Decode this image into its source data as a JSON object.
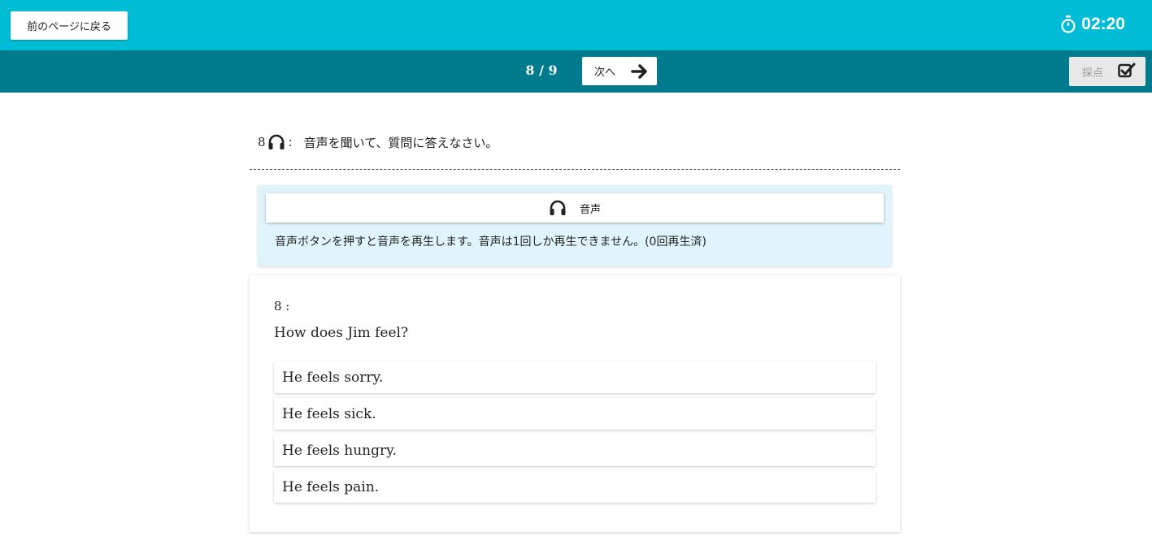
{
  "header": {
    "back_label": "前のページに戻る",
    "timer": "02:20",
    "timer_icon": "stopwatch-icon"
  },
  "nav": {
    "page_counter": "8 / 9",
    "next_label": "次へ",
    "next_icon": "arrow-right-icon",
    "grade_label": "採点",
    "grade_icon": "checkbox-checked-icon"
  },
  "question": {
    "number": "8",
    "separator": ":",
    "instruction": "音声を聞いて、質問に答えなさい。",
    "icon": "headphones-icon"
  },
  "audio": {
    "button_label": "音声",
    "note": "音声ボタンを押すと音声を再生します。音声は1回しか再生できません。(0回再生済)"
  },
  "card": {
    "number_label": "8 :",
    "question_text": "How does Jim feel?",
    "choices": [
      "He feels sorry.",
      "He feels sick.",
      "He feels hungry.",
      "He feels pain."
    ]
  },
  "colors": {
    "topbar": "#00bcd4",
    "navbar": "#007b8e",
    "audio_panel": "#dff4fb"
  }
}
